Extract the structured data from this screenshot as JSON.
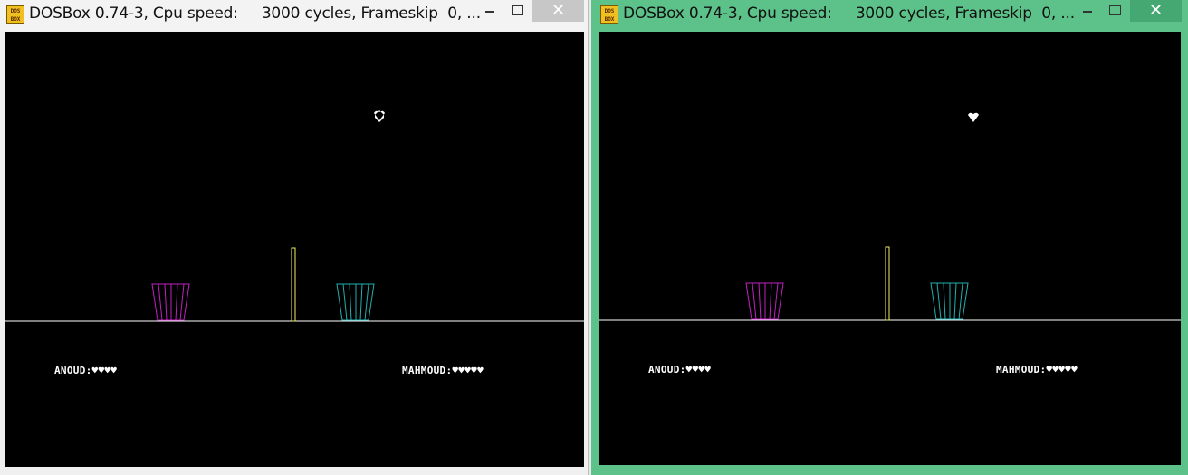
{
  "windows": [
    {
      "title": "DOSBox 0.74-3, Cpu speed:     3000 cycles, Frameskip  0, ...",
      "icon": "dosbox-icon",
      "active": false,
      "game": {
        "player1": "ANOUD:♥♥♥♥",
        "player2": "MAHMOUD:♥♥♥♥♥"
      }
    },
    {
      "title": "DOSBox 0.74-3, Cpu speed:     3000 cycles, Frameskip  0, ...",
      "icon": "dosbox-icon",
      "active": true,
      "game": {
        "player1": "ANOUD:♥♥♥♥",
        "player2": "MAHMOUD:♥♥♥♥♥"
      }
    }
  ],
  "icon_label": "DOS BOX",
  "controls": {
    "close_glyph": "✕"
  },
  "colors": {
    "active_frame": "#5cc28a",
    "basket_left": "#c020c0",
    "basket_right": "#20b0b0",
    "pole": "#f0f060",
    "ground": "#ffffff"
  }
}
